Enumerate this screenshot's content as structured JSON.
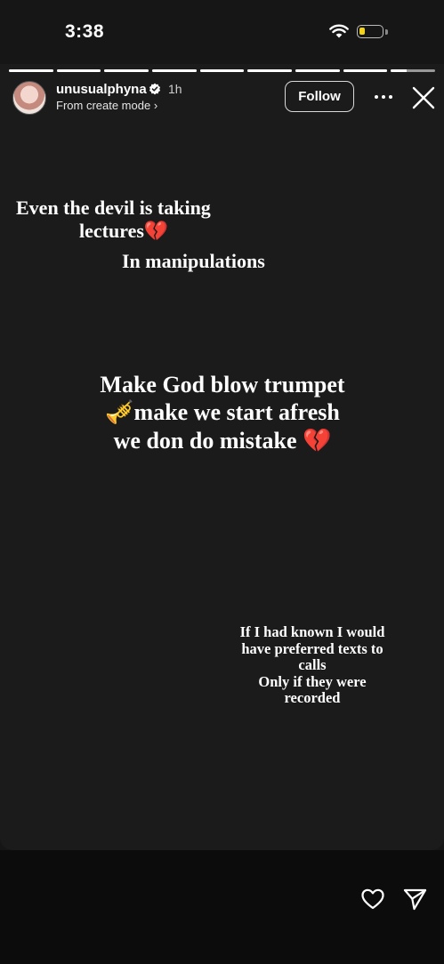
{
  "status_bar": {
    "time": "3:38",
    "battery_level": 0.25
  },
  "story": {
    "segments_total": 9,
    "segments_completed": 8,
    "current_segment_progress": 0.35,
    "username": "unusualphyna",
    "verified": true,
    "time_ago": "1h",
    "subline": "From create mode ›",
    "follow_label": "Follow",
    "texts": {
      "line1": "Even the devil is taking",
      "line2": "lectures",
      "line2_emoji": "💔",
      "line3": "In manipulations",
      "big_line1": "Make God blow trumpet",
      "big_line2_emoji": "🎺",
      "big_line2": "make we start afresh",
      "big_line3": "we don do mistake ",
      "big_line3_emoji": "💔",
      "small": [
        "If I had known I would",
        "have preferred texts to",
        "calls",
        "Only if they were",
        "recorded"
      ]
    }
  },
  "colors": {
    "background": "#161616",
    "battery": "#f2d21c",
    "heart": "#d9252f"
  },
  "icons": [
    "wifi-icon",
    "battery-icon",
    "verified-icon",
    "more-icon",
    "close-icon",
    "heart-icon",
    "share-icon"
  ]
}
